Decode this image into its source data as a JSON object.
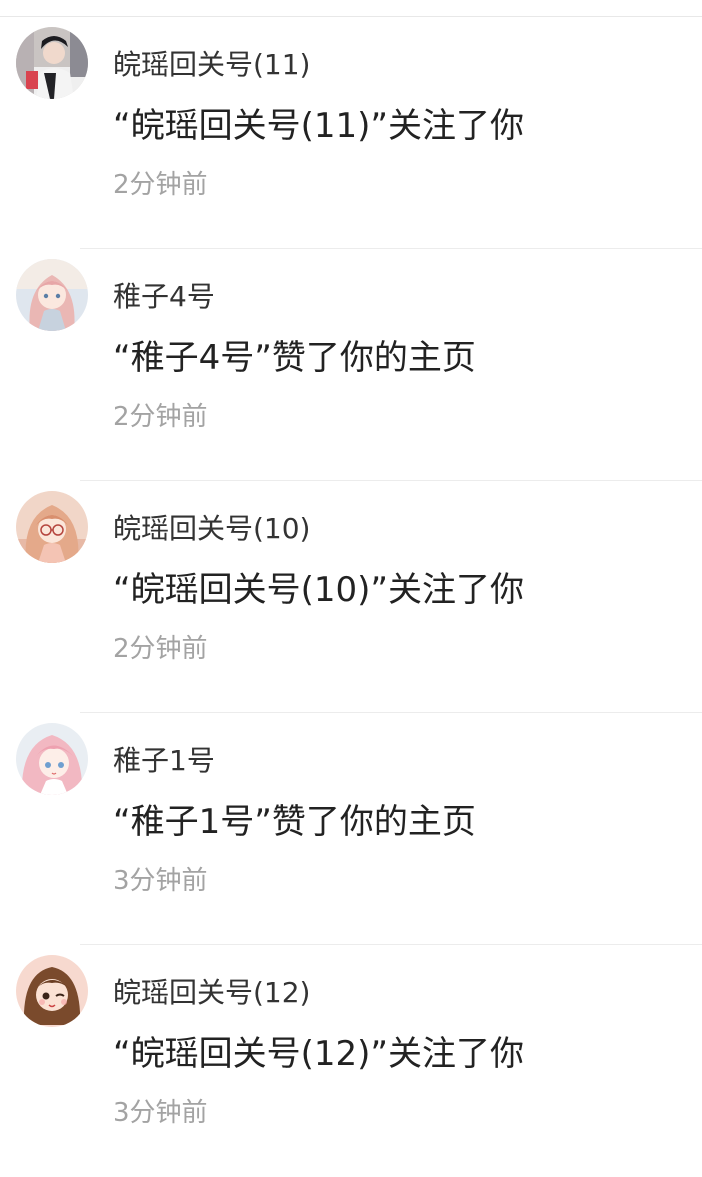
{
  "notifications": [
    {
      "username": "皖瑶回关号(11)",
      "message": "“皖瑶回关号(11)”关注了你",
      "time": "2分钟前",
      "avatar_icon": "avatar-boy-dark-hair-icon"
    },
    {
      "username": "稚子4号",
      "message": "“稚子4号”赞了你的主页",
      "time": "2分钟前",
      "avatar_icon": "avatar-anime-girl-pink-hair-icon"
    },
    {
      "username": "皖瑶回关号(10)",
      "message": "“皖瑶回关号(10)”关注了你",
      "time": "2分钟前",
      "avatar_icon": "avatar-anime-girl-glasses-icon"
    },
    {
      "username": "稚子1号",
      "message": "“稚子1号”赞了你的主页",
      "time": "3分钟前",
      "avatar_icon": "avatar-anime-girl-pink-hair-icon"
    },
    {
      "username": "皖瑶回关号(12)",
      "message": "“皖瑶回关号(12)”关注了你",
      "time": "3分钟前",
      "avatar_icon": "avatar-anime-girl-wink-icon"
    }
  ]
}
